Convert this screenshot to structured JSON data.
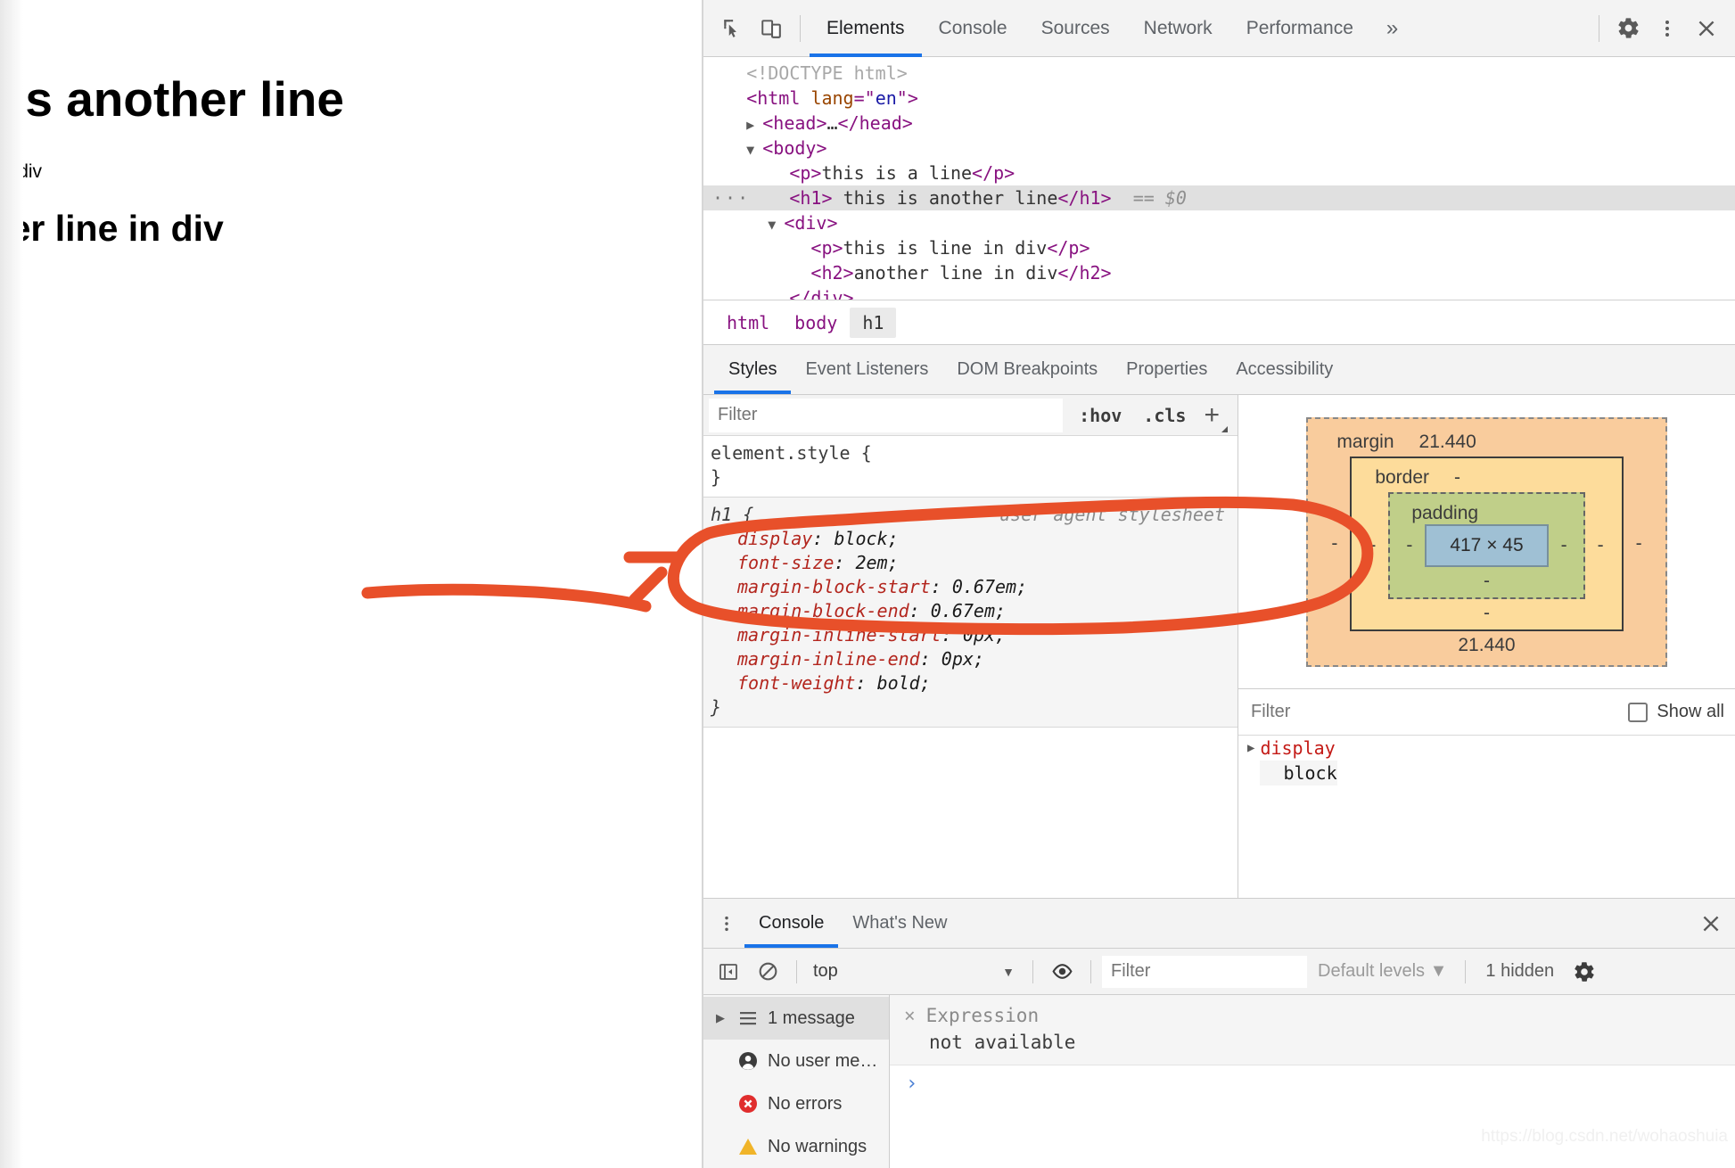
{
  "page": {
    "lines": [
      {
        "kind": "p",
        "text": "this is a line"
      },
      {
        "kind": "h1",
        "text": "this is another line"
      },
      {
        "kind": "p",
        "text": "this is line in div"
      },
      {
        "kind": "h2",
        "text": "another line in div"
      }
    ]
  },
  "toolbar": {
    "inspect_icon": "inspect-cursor-icon",
    "device_icon": "device-toolbar-icon",
    "tabs": [
      {
        "label": "Elements",
        "active": true
      },
      {
        "label": "Console",
        "active": false
      },
      {
        "label": "Sources",
        "active": false
      },
      {
        "label": "Network",
        "active": false
      },
      {
        "label": "Performance",
        "active": false
      }
    ],
    "more_label": "»",
    "settings_icon": "gear-icon",
    "kebab_icon": "more-vertical-icon",
    "close_icon": "close-icon"
  },
  "dom": {
    "lines": [
      {
        "indent": 0,
        "tri": "",
        "selected": false,
        "parts": [
          {
            "c": "doct",
            "t": "<!DOCTYPE html>"
          }
        ]
      },
      {
        "indent": 0,
        "tri": "",
        "selected": false,
        "parts": [
          {
            "c": "tw",
            "t": "<html "
          },
          {
            "c": "attr",
            "t": "lang"
          },
          {
            "c": "tw",
            "t": "=\""
          },
          {
            "c": "aval",
            "t": "en"
          },
          {
            "c": "tw",
            "t": "\">"
          }
        ]
      },
      {
        "indent": 1,
        "tri": "▶",
        "selected": false,
        "parts": [
          {
            "c": "tw",
            "t": "<head>"
          },
          {
            "c": "txt",
            "t": "…"
          },
          {
            "c": "tw",
            "t": "</head>"
          }
        ]
      },
      {
        "indent": 1,
        "tri": "▼",
        "selected": false,
        "parts": [
          {
            "c": "tw",
            "t": "<body>"
          }
        ]
      },
      {
        "indent": 2,
        "tri": "",
        "selected": false,
        "parts": [
          {
            "c": "tw",
            "t": "<p>"
          },
          {
            "c": "txt",
            "t": "this is a line"
          },
          {
            "c": "tw",
            "t": "</p>"
          }
        ]
      },
      {
        "indent": 2,
        "tri": "",
        "selected": true,
        "dots": "···",
        "parts": [
          {
            "c": "tw",
            "t": "<h1> "
          },
          {
            "c": "txt",
            "t": "this is another line"
          },
          {
            "c": "tw",
            "t": "</h1>"
          },
          {
            "c": "dollar",
            "t": "  == $0"
          }
        ]
      },
      {
        "indent": 2,
        "tri": "▼",
        "selected": false,
        "parts": [
          {
            "c": "tw",
            "t": "<div>"
          }
        ]
      },
      {
        "indent": 3,
        "tri": "",
        "selected": false,
        "parts": [
          {
            "c": "tw",
            "t": "<p>"
          },
          {
            "c": "txt",
            "t": "this is line in div"
          },
          {
            "c": "tw",
            "t": "</p>"
          }
        ]
      },
      {
        "indent": 3,
        "tri": "",
        "selected": false,
        "parts": [
          {
            "c": "tw",
            "t": "<h2>"
          },
          {
            "c": "txt",
            "t": "another line in div"
          },
          {
            "c": "tw",
            "t": "</h2>"
          }
        ]
      },
      {
        "indent": 2,
        "tri": "",
        "selected": false,
        "parts": [
          {
            "c": "tw",
            "t": "</div>"
          }
        ]
      },
      {
        "indent": 1,
        "tri": "",
        "selected": false,
        "parts": [
          {
            "c": "tw",
            "t": "</body>"
          }
        ]
      }
    ]
  },
  "breadcrumb": {
    "items": [
      {
        "label": "html",
        "active": false
      },
      {
        "label": "body",
        "active": false
      },
      {
        "label": "h1",
        "active": true
      }
    ]
  },
  "styles_tabs": [
    {
      "label": "Styles",
      "active": true
    },
    {
      "label": "Event Listeners",
      "active": false
    },
    {
      "label": "DOM Breakpoints",
      "active": false
    },
    {
      "label": "Properties",
      "active": false
    },
    {
      "label": "Accessibility",
      "active": false
    }
  ],
  "styles": {
    "filter_placeholder": "Filter",
    "filter_value": "",
    "hov_label": ":hov",
    "cls_label": ".cls",
    "plus_label": "+",
    "rules": [
      {
        "selector": "element.style {",
        "origin": "",
        "ua": false,
        "declarations": [],
        "close": "}"
      },
      {
        "selector": "h1 {",
        "origin": "user agent stylesheet",
        "ua": true,
        "declarations": [
          {
            "prop": "display",
            "value": "block;"
          },
          {
            "prop": "font-size",
            "value": "2em;"
          },
          {
            "prop": "margin-block-start",
            "value": "0.67em;"
          },
          {
            "prop": "margin-block-end",
            "value": "0.67em;"
          },
          {
            "prop": "margin-inline-start",
            "value": "0px;"
          },
          {
            "prop": "margin-inline-end",
            "value": "0px;"
          },
          {
            "prop": "font-weight",
            "value": "bold;"
          }
        ],
        "close": "}"
      }
    ]
  },
  "box_model": {
    "margin_label": "margin",
    "margin_top": "21.440",
    "margin_bottom": "21.440",
    "margin_left": "-",
    "margin_right": "-",
    "border_label": "border",
    "border_top": "-",
    "border_bottom": "-",
    "border_left": "-",
    "border_right": "-",
    "padding_label": "padding",
    "padding_top": "",
    "padding_bottom": "-",
    "padding_left": "-",
    "padding_right": "-",
    "content_size": "417 × 45",
    "colors": {
      "margin": "#f9cc9d",
      "border": "#fddc9b",
      "padding": "#c0cf89",
      "content": "#9fc0d4"
    }
  },
  "computed": {
    "filter_placeholder": "Filter",
    "show_all_label": "Show all",
    "show_all_checked": false,
    "properties": [
      {
        "name": "display",
        "value": "block"
      }
    ]
  },
  "drawer": {
    "kebab_icon": "more-vertical-icon",
    "tabs": [
      {
        "label": "Console",
        "active": true
      },
      {
        "label": "What's New",
        "active": false
      }
    ],
    "close_icon": "close-icon",
    "sidebar_toggle_icon": "console-sidebar-icon",
    "clear_icon": "clear-console-icon",
    "context": "top",
    "eye_icon": "live-expression-icon",
    "filter_placeholder": "Filter",
    "levels_label": "Default levels",
    "hidden_label": "1 hidden",
    "settings_icon": "gear-icon",
    "sidebar": [
      {
        "label": "1 message",
        "icon": "list-icon",
        "selected": true
      },
      {
        "label": "No user me…",
        "icon": "user-icon",
        "selected": false
      },
      {
        "label": "No errors",
        "icon": "error-icon",
        "selected": false
      },
      {
        "label": "No warnings",
        "icon": "warning-icon",
        "selected": false
      }
    ],
    "message": {
      "close_glyph": "×",
      "line1": "Expression",
      "line2": "not available"
    },
    "prompt_glyph": "›"
  },
  "annotation": {
    "color": "#e8502a",
    "description": "hand-drawn-circle-around-element-style-rule"
  },
  "watermark": "https://blog.csdn.net/wohaoshuia"
}
